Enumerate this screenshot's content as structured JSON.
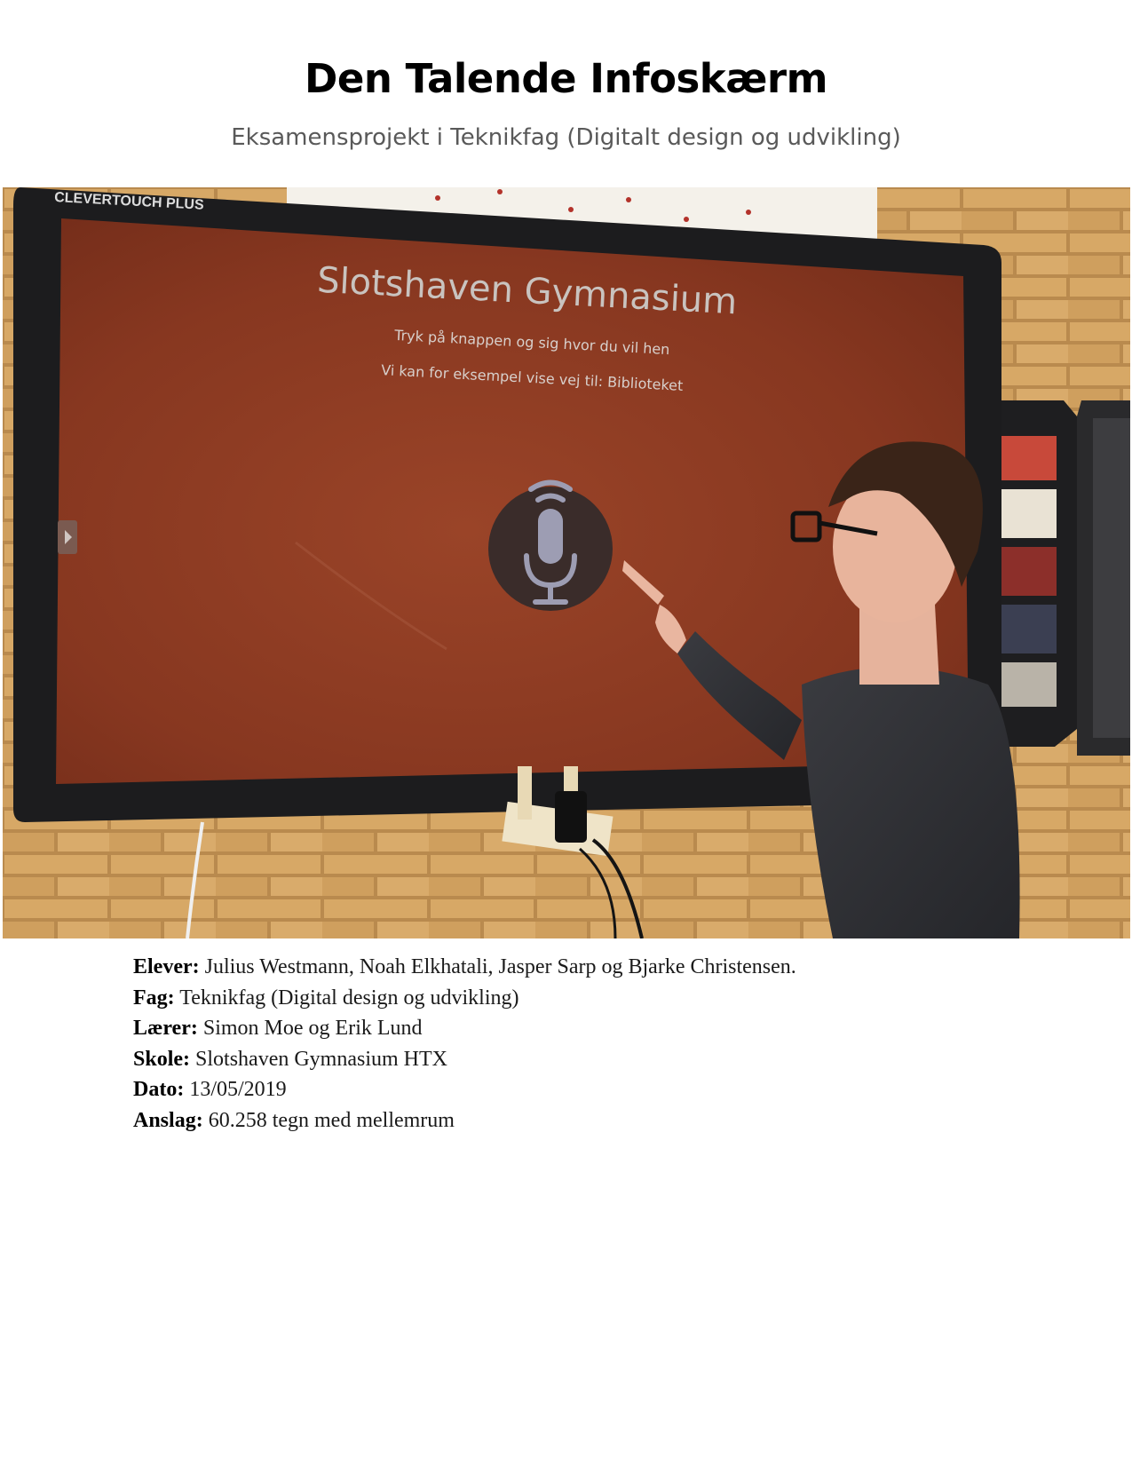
{
  "document": {
    "title": "Den Talende Infoskærm",
    "subtitle": "Eksamensprojekt i Teknikfag (Digitalt design og udvikling)"
  },
  "photo": {
    "screen_brand": "CLEVERTOUCH PLUS",
    "screen_heading": "Slotshaven Gymnasium",
    "screen_line1": "Tryk på knappen og sig hvor du vil hen",
    "screen_line2": "Vi kan for eksempel vise vej til: Biblioteket",
    "icon": "microphone-icon",
    "colors": {
      "screen_background": "#8a3a22",
      "bezel": "#1c1c1e",
      "brick_wall": "#c99a5c"
    }
  },
  "details": [
    {
      "label": "Elever:",
      "value": "Julius Westmann, Noah Elkhatali, Jasper Sarp og Bjarke Christensen."
    },
    {
      "label": "Fag:",
      "value": "Teknikfag (Digital design og udvikling)"
    },
    {
      "label": "Lærer:",
      "value": "Simon Moe og Erik Lund"
    },
    {
      "label": "Skole:",
      "value": "Slotshaven Gymnasium HTX"
    },
    {
      "label": "Dato:",
      "value": "13/05/2019"
    },
    {
      "label": "Anslag:",
      "value": "60.258 tegn med mellemrum"
    }
  ]
}
